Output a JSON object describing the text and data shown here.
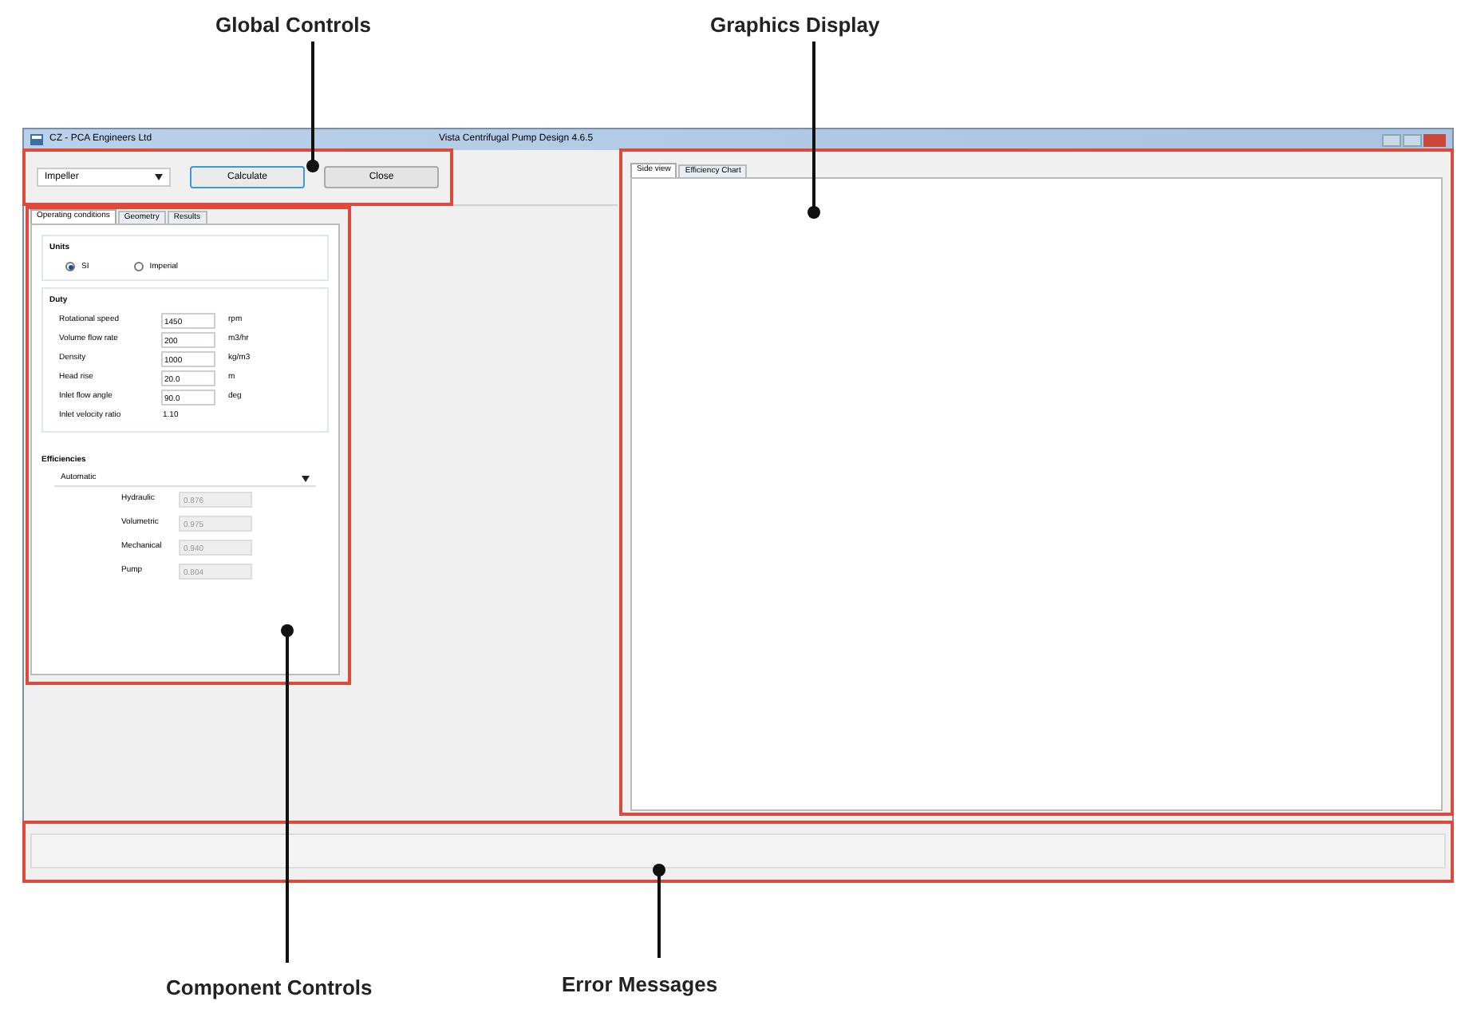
{
  "window": {
    "title": "CZ - PCA Engineers Ltd",
    "app_title": "Vista Centrifugal Pump Design 4.6.5"
  },
  "global_controls": {
    "component": "Impeller",
    "buttons": [
      "Calculate",
      "Close"
    ]
  },
  "component_tabs": [
    {
      "label": "Operating conditions",
      "selected": true
    },
    {
      "label": "Geometry",
      "selected": false
    },
    {
      "label": "Results",
      "selected": false
    }
  ],
  "units": {
    "title": "Units",
    "options": [
      {
        "label": "SI",
        "selected": true
      },
      {
        "label": "Imperial",
        "selected": false
      }
    ]
  },
  "duty": {
    "title": "Duty",
    "rows": [
      {
        "label": "Rotational speed",
        "value": "1450",
        "unit": "rpm",
        "editable": true
      },
      {
        "label": "Volume flow rate",
        "value": "200",
        "unit": "m3/hr",
        "editable": true
      },
      {
        "label": "Density",
        "value": "1000",
        "unit": "kg/m3",
        "editable": true
      },
      {
        "label": "Head rise",
        "value": "20.0",
        "unit": "m",
        "editable": true
      },
      {
        "label": "Inlet flow angle",
        "value": "90.0",
        "unit": "deg",
        "editable": true
      },
      {
        "label": "Inlet velocity ratio",
        "value": "1.10",
        "editable": false
      }
    ]
  },
  "efficiencies": {
    "title": "Efficiencies",
    "mode": "Automatic",
    "rows": [
      {
        "label": "Hydraulic",
        "value": "0.876",
        "disabled": true
      },
      {
        "label": "Volumetric",
        "value": "0.975",
        "disabled": true
      },
      {
        "label": "Mechanical",
        "value": "0.940",
        "disabled": true
      },
      {
        "label": "Pump",
        "value": "0.804",
        "disabled": true
      }
    ]
  },
  "graphics_tabs": [
    {
      "label": "Side view",
      "selected": true
    },
    {
      "label": "Efficiency Chart",
      "selected": false
    }
  ],
  "annotations": [
    {
      "label": "Global Controls"
    },
    {
      "label": "Graphics Display"
    },
    {
      "label": "Component Controls"
    },
    {
      "label": "Error Messages"
    }
  ]
}
